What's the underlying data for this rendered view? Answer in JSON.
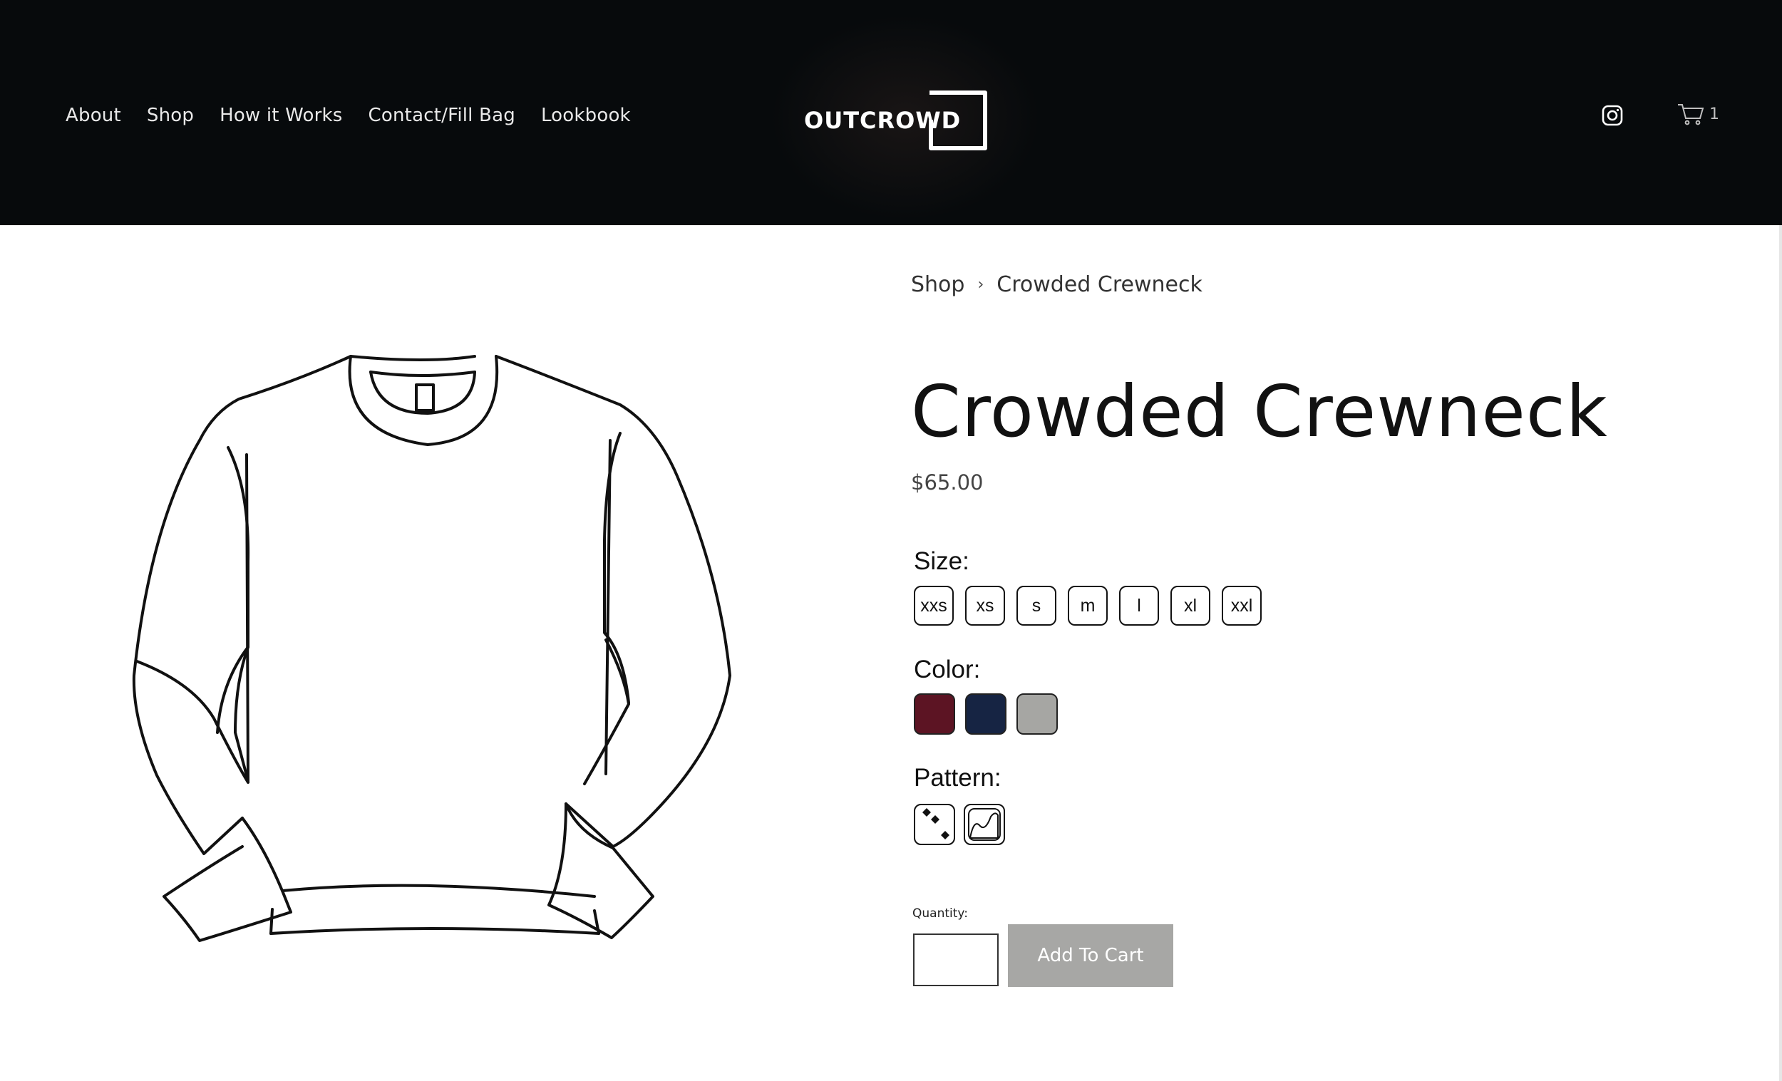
{
  "header": {
    "nav": [
      {
        "label": "About"
      },
      {
        "label": "Shop"
      },
      {
        "label": "How it Works"
      },
      {
        "label": "Contact/Fill Bag"
      },
      {
        "label": "Lookbook"
      }
    ],
    "logo_text": "OUTCROWD",
    "social_icon": "instagram-icon",
    "cart_icon": "cart-icon",
    "cart_count": "1"
  },
  "breadcrumb": {
    "items": [
      "Shop",
      "Crowded Crewneck"
    ],
    "separator": "›"
  },
  "product": {
    "title": "Crowded Crewneck",
    "price": "$65.00",
    "size_label": "Size:",
    "sizes": [
      "xxs",
      "xs",
      "s",
      "m",
      "l",
      "xl",
      "xxl"
    ],
    "color_label": "Color:",
    "colors": [
      "#5c1423",
      "#162443",
      "#a6a6a3"
    ],
    "pattern_label": "Pattern:",
    "patterns": [
      "dots-pattern-icon",
      "wave-pattern-icon"
    ],
    "quantity_label": "Quantity:",
    "quantity_value": "",
    "add_to_cart_label": "Add To Cart",
    "image_icon": "crewneck-sweatshirt-illustration"
  }
}
